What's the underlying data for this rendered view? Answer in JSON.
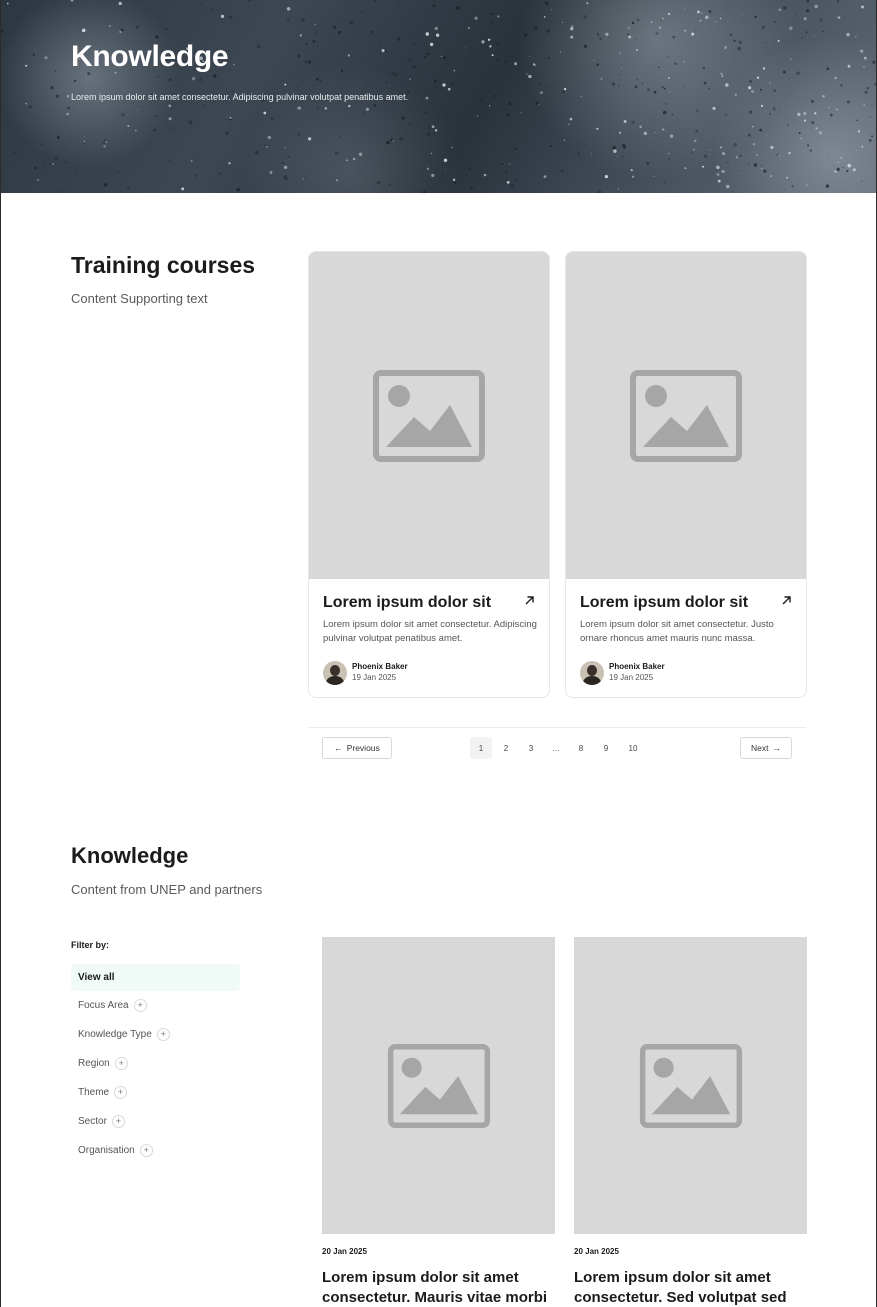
{
  "hero": {
    "title": "Knowledge",
    "subtitle": "Lorem ipsum dolor sit amet consectetur. Adipiscing pulvinar volutpat penatibus amet."
  },
  "training": {
    "title": "Training courses",
    "subtitle": "Content Supporting text",
    "cards": [
      {
        "image_icon": "image-placeholder-icon",
        "title": "Lorem ipsum dolor sit",
        "arrow_icon": "arrow-up-right-icon",
        "description": "Lorem ipsum dolor sit amet consectetur. Adipiscing pulvinar volutpat penatibus amet.",
        "author": "Phoenix Baker",
        "date": "19 Jan 2025"
      },
      {
        "image_icon": "image-placeholder-icon",
        "title": "Lorem ipsum dolor sit",
        "arrow_icon": "arrow-up-right-icon",
        "description": "Lorem ipsum dolor sit amet consectetur. Justo ornare rhoncus amet mauris nunc massa.",
        "author": "Phoenix Baker",
        "date": "19 Jan 2025"
      }
    ],
    "pagination": {
      "previous_label": "Previous",
      "next_label": "Next",
      "pages": [
        "1",
        "2",
        "3",
        "...",
        "8",
        "9",
        "10"
      ],
      "current_page": "1"
    }
  },
  "knowledge": {
    "title": "Knowledge",
    "subtitle": "Content from UNEP and partners",
    "filter_label": "Filter by:",
    "filter_all": "View all",
    "filters": [
      "Focus Area",
      "Knowledge Type",
      "Region",
      "Theme",
      "Sector",
      "Organisation"
    ],
    "cards": [
      {
        "date": "20 Jan 2025",
        "title": "Lorem ipsum dolor sit amet consectetur. Mauris vitae morbi"
      },
      {
        "date": "20 Jan 2025",
        "title": "Lorem ipsum dolor sit amet consectetur. Sed volutpat sed"
      }
    ]
  }
}
